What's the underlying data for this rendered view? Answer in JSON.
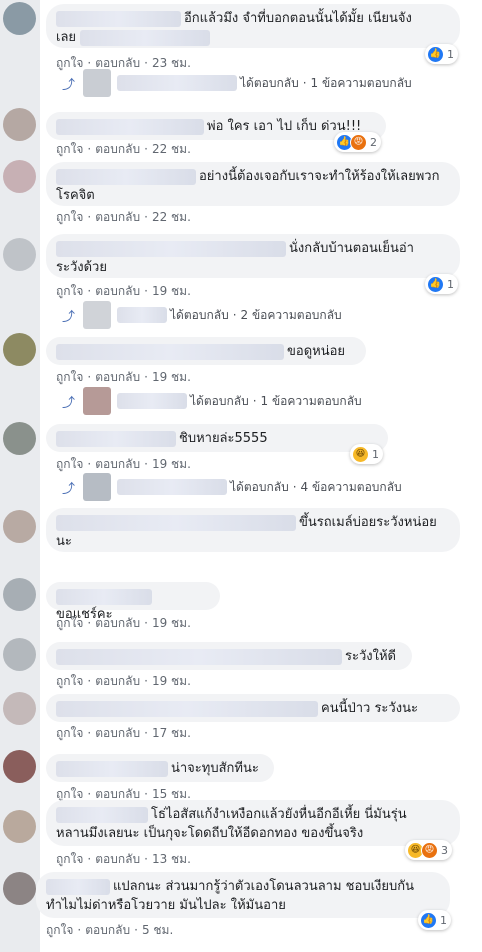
{
  "actions": {
    "like": "ถูกใจ",
    "reply": "ตอบกลับ",
    "dot": "·"
  },
  "reply_summary": {
    "replied": "ได้ตอบกลับ"
  },
  "comments": [
    {
      "text": "อีกแล้วมึง จำที่บอกตอนนั้นได้มั้ย เนียนจัง",
      "text2": "เลย",
      "time": "23 ชม.",
      "reaction_count": "1"
    },
    {
      "text": "พ่อ ใคร เอา ไป เก็บ ด่วน!!!",
      "time": "22 ชม.",
      "reaction_count": "2"
    },
    {
      "text": "อย่างนี้ต้องเจอกับเราจะทำให้ร้องให้เลยพวก",
      "text2": "โรคจิต",
      "time": "22 ชม."
    },
    {
      "text": "นั่งกลับบ้านตอนเย็นอ่า",
      "text2": "ระวังด้วย",
      "time": "19 ชม.",
      "reaction_count": "1"
    },
    {
      "text": "ขอดูหน่อย",
      "time": "19 ชม."
    },
    {
      "text": "ชิบหายล่ะ5555",
      "time": "19 ชม.",
      "reaction_count": "1"
    },
    {
      "text": "ขึ้นรถเมล์บ่อยระวังหน่อย",
      "text2": "นะ",
      "time": ""
    },
    {
      "text": "ขอแชร์คะ",
      "time": "19 ชม."
    },
    {
      "text": "ระวังให้ดี",
      "time": "19 ชม."
    },
    {
      "text": "คนนี้ป่าว ระวังนะ",
      "time": "17 ชม."
    },
    {
      "text": "น่าจะทุบสักทีนะ",
      "time": "15 ชม."
    },
    {
      "text": "โธ่ไอสัสแก้งำเหงือกแล้วยังหื่นอีกอีเหี้ย นี่มันรุ่น",
      "text2": "หลานมึงเลยนะ เป็นกุจะโดดถีบให้อีดอกทอง ของขึ้นจริง",
      "time": "13 ชม.",
      "reaction_count": "3"
    },
    {
      "text": "แปลกนะ ส่วนมากรู้ว่าตัวเองโดนลวนลาม ชอบเงียบกัน",
      "text2": "ทำไมไม่ด่าหรือโวยวาย มันไปละ ให้มันอาย",
      "time": "5 ชม.",
      "reaction_count": "1"
    }
  ],
  "replies": [
    {
      "count_text": "1 ข้อความตอบกลับ"
    },
    {
      "count_text": "2 ข้อความตอบกลับ"
    },
    {
      "count_text": "1 ข้อความตอบกลับ"
    },
    {
      "count_text": "4 ข้อความตอบกลับ"
    }
  ],
  "icons": {
    "like": "like-reaction-icon",
    "haha": "haha-reaction-icon",
    "angry": "angry-reaction-icon",
    "reply_arrow": "reply-arrow-icon"
  },
  "colors": {
    "bubble": "#f2f3f5",
    "link": "#385898",
    "like": "#2078f4",
    "meta": "#616770"
  }
}
